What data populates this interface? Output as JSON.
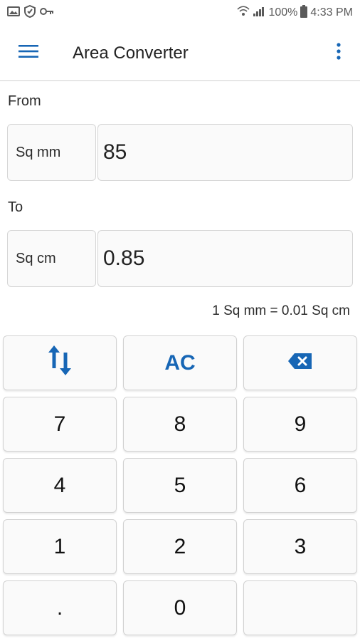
{
  "status": {
    "battery": "100%",
    "time": "4:33 PM"
  },
  "appbar": {
    "title": "Area Converter"
  },
  "from": {
    "label": "From",
    "unit": "Sq mm",
    "value": "85"
  },
  "to": {
    "label": "To",
    "unit": "Sq cm",
    "value": "0.85"
  },
  "formula": "1 Sq mm = 0.01 Sq cm",
  "keys": {
    "ac": "AC",
    "k7": "7",
    "k8": "8",
    "k9": "9",
    "k4": "4",
    "k5": "5",
    "k6": "6",
    "k1": "1",
    "k2": "2",
    "k3": "3",
    "dot": ".",
    "k0": "0",
    "blank": ""
  },
  "colors": {
    "accent": "#1766b5",
    "divider": "#cfcfcf",
    "key_bg": "#fafafa"
  }
}
